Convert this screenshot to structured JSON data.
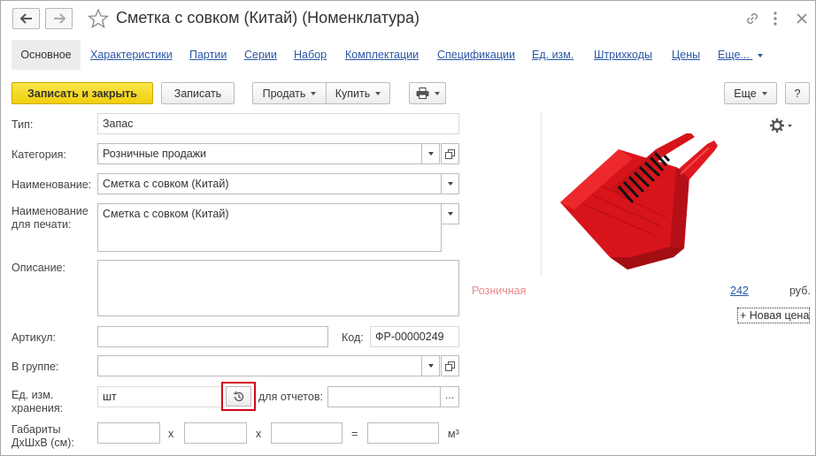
{
  "header": {
    "title": "Сметка с совком (Китай) (Номенклатура)"
  },
  "tabs": [
    {
      "label": "Основное",
      "active": true
    },
    {
      "label": "Характеристики"
    },
    {
      "label": "Партии"
    },
    {
      "label": "Серии"
    },
    {
      "label": "Набор"
    },
    {
      "label": "Комплектации"
    },
    {
      "label": "Спецификации"
    },
    {
      "label": "Ед. изм."
    },
    {
      "label": "Штрихкоды"
    },
    {
      "label": "Цены"
    },
    {
      "label": "Еще..."
    }
  ],
  "toolbar": {
    "save_close": "Записать и закрыть",
    "save": "Записать",
    "sell": "Продать",
    "buy": "Купить",
    "more": "Еще",
    "help": "?"
  },
  "form": {
    "type_label": "Тип:",
    "type_value": "Запас",
    "category_label": "Категория:",
    "category_value": "Розничные продажи",
    "name_label": "Наименование:",
    "name_value": "Сметка с совком (Китай)",
    "print_name_label_1": "Наименование",
    "print_name_label_2": "для печати:",
    "print_name_value": "Сметка с совком (Китай)",
    "description_label": "Описание:",
    "description_value": "",
    "article_label": "Артикул:",
    "article_value": "",
    "code_label": "Код:",
    "code_value": "ФР-00000249",
    "group_label": "В группе:",
    "group_value": "",
    "unit_label_1": "Ед. изм.",
    "unit_label_2": "хранения:",
    "unit_value": "шт",
    "report_unit_label": "для отчетов:",
    "report_unit_value": "",
    "dims_label_1": "Габариты",
    "dims_label_2": "ДхШхВ (см):",
    "x1": "x",
    "x2": "x",
    "eq": "=",
    "m3": "м³",
    "ellipsis": "..."
  },
  "price": {
    "kind": "Розничная",
    "value": "242",
    "currency": "руб.",
    "new_price": "+ Новая цена"
  },
  "colors": {
    "link": "#2a57a4",
    "accent_yellow": "#f5d81c",
    "highlight_red": "#d0021b",
    "retail_label": "#e88888"
  }
}
